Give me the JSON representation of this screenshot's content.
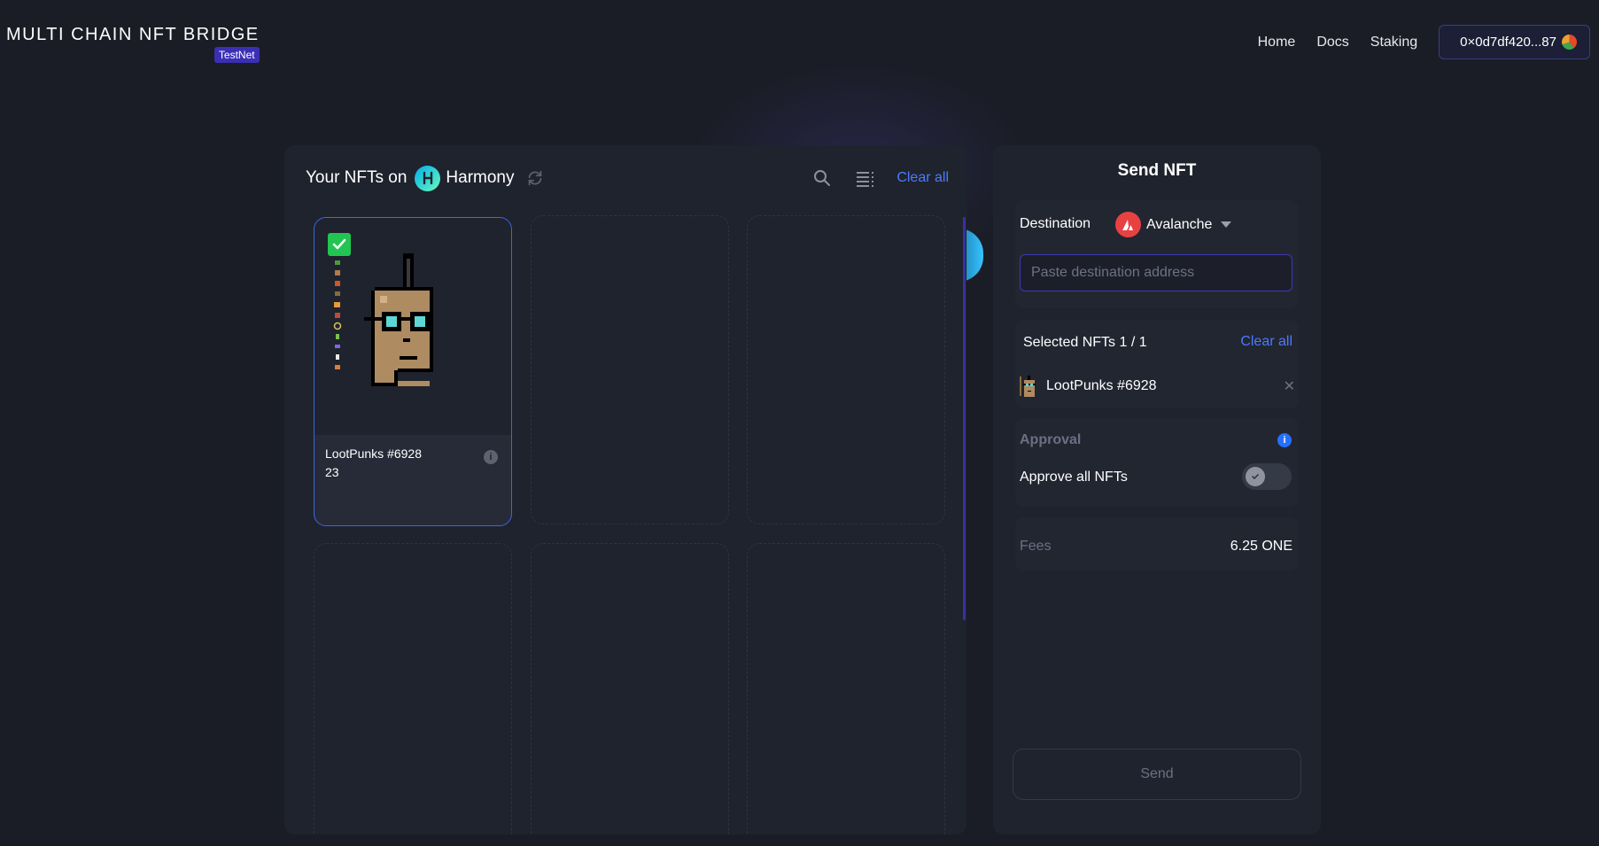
{
  "header": {
    "logo_title": "MULTI CHAIN NFT BRIDGE",
    "logo_badge": "TestNet",
    "nav": [
      {
        "label": "Home"
      },
      {
        "label": "Docs"
      },
      {
        "label": "Staking"
      }
    ],
    "wallet_address": "0×0d7df420...87"
  },
  "nft_panel": {
    "title": "Your NFTs on",
    "chain": "Harmony",
    "clear_all": "Clear all",
    "nfts": [
      {
        "name": "LootPunks #6928",
        "number": "23",
        "selected": true
      }
    ]
  },
  "send_panel": {
    "title": "Send NFT",
    "destination_label": "Destination",
    "destination_chain": "Avalanche",
    "address_placeholder": "Paste destination address",
    "selected_label": "Selected NFTs  1 / 1",
    "clear_all": "Clear all",
    "selected_items": [
      {
        "name": "LootPunks #6928"
      }
    ],
    "approval_label": "Approval",
    "approve_all_label": "Approve all NFTs",
    "approve_all_enabled": false,
    "fees_label": "Fees",
    "fees_value": "6.25 ONE",
    "send_label": "Send"
  },
  "colors": {
    "background": "#1a1d26",
    "panel": "#1f232d",
    "accent": "#4b7bff",
    "badge": "#3b2fb5",
    "check": "#23c552",
    "avalanche": "#e84142"
  }
}
